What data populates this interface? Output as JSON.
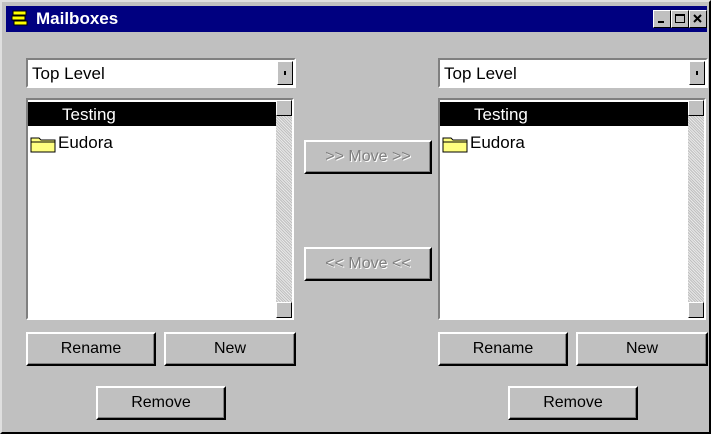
{
  "window": {
    "title": "Mailboxes",
    "controls": [
      "_",
      "□",
      "x"
    ]
  },
  "left_pane": {
    "location": "Top Level",
    "items": [
      {
        "label": "Testing",
        "selected": true,
        "icon": "none"
      },
      {
        "label": "Eudora",
        "selected": false,
        "icon": "folder-icon"
      }
    ],
    "rename_label": "Rename",
    "new_label": "New",
    "remove_label": "Remove"
  },
  "right_pane": {
    "location": "Top Level",
    "items": [
      {
        "label": "Testing",
        "selected": true,
        "icon": "none"
      },
      {
        "label": "Eudora",
        "selected": false,
        "icon": "folder-icon"
      }
    ],
    "rename_label": "Rename",
    "new_label": "New",
    "remove_label": "Remove"
  },
  "middle": {
    "move_right_label": ">> Move >>",
    "move_left_label": "<< Move <<"
  },
  "colors": {
    "titlebar": "#000080",
    "face": "#c0c0c0",
    "selection": "#000000",
    "folder": "#ffff80"
  }
}
